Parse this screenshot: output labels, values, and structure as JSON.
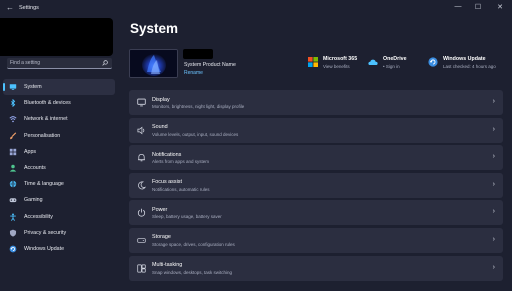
{
  "window": {
    "back_icon": "back-arrow-icon",
    "title": "Settings",
    "controls": [
      "—",
      "☐",
      "✕"
    ]
  },
  "search": {
    "placeholder": "Find a setting",
    "icon": "search-icon"
  },
  "sidebar": {
    "items": [
      {
        "label": "System",
        "icon": "monitor-icon",
        "active": true
      },
      {
        "label": "Bluetooth & devices",
        "icon": "bluetooth-icon"
      },
      {
        "label": "Network & internet",
        "icon": "wifi-icon"
      },
      {
        "label": "Personalisation",
        "icon": "brush-icon"
      },
      {
        "label": "Apps",
        "icon": "apps-icon"
      },
      {
        "label": "Accounts",
        "icon": "person-icon"
      },
      {
        "label": "Time & language",
        "icon": "globe-icon"
      },
      {
        "label": "Gaming",
        "icon": "gamepad-icon"
      },
      {
        "label": "Accessibility",
        "icon": "accessibility-icon"
      },
      {
        "label": "Privacy & security",
        "icon": "shield-icon"
      },
      {
        "label": "Windows Update",
        "icon": "update-icon"
      }
    ]
  },
  "main": {
    "title": "System",
    "device": {
      "model": "System Product Name",
      "rename": "Rename"
    },
    "quick_links": [
      {
        "title": "Microsoft 365",
        "sub": "View benefits",
        "icon": "microsoft-logo-icon"
      },
      {
        "title": "OneDrive",
        "sub": "• Sign in",
        "icon": "cloud-icon"
      },
      {
        "title": "Windows Update",
        "sub": "Last checked: 4 hours ago",
        "icon": "update-icon"
      }
    ],
    "cards": [
      {
        "title": "Display",
        "sub": "Monitors, brightness, night light, display profile",
        "icon": "display-icon"
      },
      {
        "title": "Sound",
        "sub": "Volume levels, output, input, sound devices",
        "icon": "speaker-icon"
      },
      {
        "title": "Notifications",
        "sub": "Alerts from apps and system",
        "icon": "bell-icon"
      },
      {
        "title": "Focus assist",
        "sub": "Notifications, automatic rules",
        "icon": "moon-icon"
      },
      {
        "title": "Power",
        "sub": "Sleep, battery usage, battery saver",
        "icon": "power-icon"
      },
      {
        "title": "Storage",
        "sub": "Storage space, drives, configuration rules",
        "icon": "storage-icon"
      },
      {
        "title": "Multi-tasking",
        "sub": "Snap windows, desktops, task switching",
        "icon": "multitask-icon"
      }
    ]
  },
  "colors": {
    "background": "#1d2030",
    "card": "#2b2e40",
    "accent": "#4cc2ff",
    "link": "#6cc4ff"
  }
}
